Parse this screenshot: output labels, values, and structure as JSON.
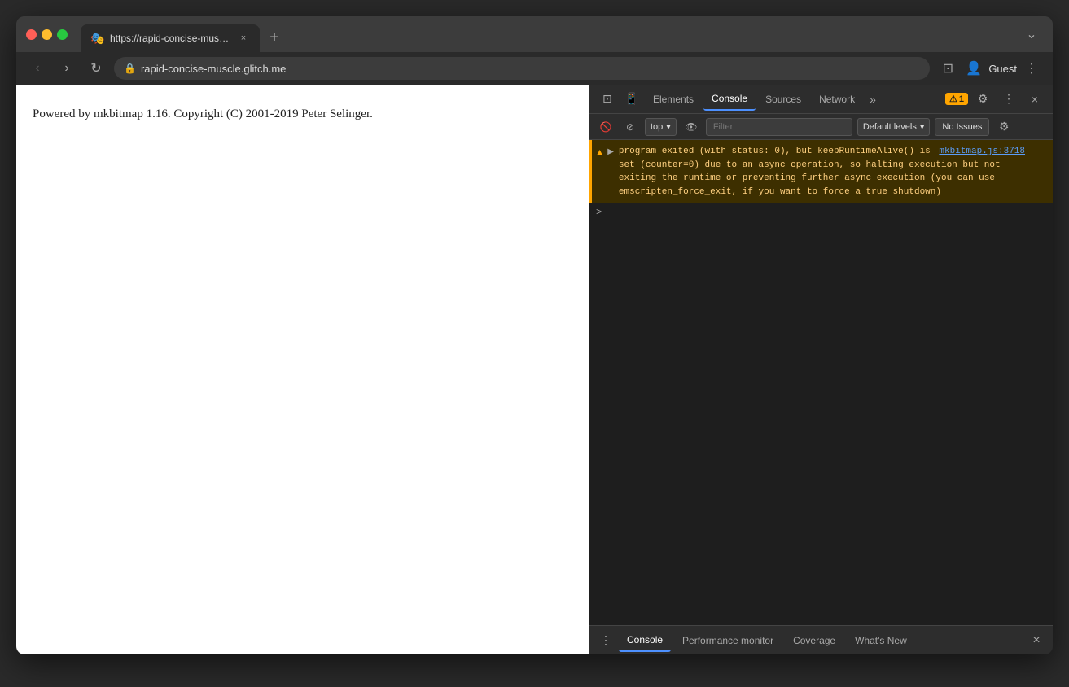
{
  "browser": {
    "tab": {
      "favicon": "🎭",
      "title": "https://rapid-concise-muscle.g...",
      "close_label": "×"
    },
    "new_tab_label": "+",
    "window_controls": {
      "close": "close",
      "minimize": "minimize",
      "maximize": "maximize"
    },
    "address_bar": {
      "url": "rapid-concise-muscle.glitch.me",
      "lock_icon": "🔒"
    },
    "nav": {
      "back_label": "‹",
      "forward_label": "›",
      "reload_label": "↻"
    },
    "profile": "Guest",
    "chevron_label": "⌄"
  },
  "page": {
    "content": "Powered by mkbitmap 1.16. Copyright (C) 2001-2019 Peter Selinger."
  },
  "devtools": {
    "tabs": [
      {
        "label": "Elements",
        "active": false
      },
      {
        "label": "Console",
        "active": true
      },
      {
        "label": "Sources",
        "active": false
      },
      {
        "label": "Network",
        "active": false
      }
    ],
    "more_tabs_label": "»",
    "warning_count": "1",
    "settings_icon": "⚙",
    "more_options_icon": "⋮",
    "close_icon": "×",
    "inspect_icon": "⊡",
    "device_icon": "📱",
    "console": {
      "toolbar": {
        "clear_icon": "🚫",
        "filter_icon": "⊘",
        "context": "top",
        "context_arrow": "▾",
        "eye_icon": "👁",
        "filter_placeholder": "Filter",
        "log_levels": "Default levels",
        "log_levels_arrow": "▾",
        "no_issues": "No Issues",
        "settings_icon": "⚙"
      },
      "warning": {
        "triangle": "▲",
        "expand": "▶",
        "text_line1": " program exited (with status: 0), but keepRuntimeAlive() is",
        "link_text": "mkbitmap.js:3718",
        "text_line2": "set (counter=0) due to an async operation, so halting execution but not",
        "text_line3": "exiting the runtime or preventing further async execution (you can use",
        "text_line4": "emscripten_force_exit, if you want to force a true shutdown)"
      },
      "prompt_arrow": ">"
    },
    "bottom_bar": {
      "more_icon": "⋮",
      "tabs": [
        {
          "label": "Console",
          "active": true
        },
        {
          "label": "Performance monitor",
          "active": false
        },
        {
          "label": "Coverage",
          "active": false
        },
        {
          "label": "What's New",
          "active": false
        }
      ],
      "close_icon": "×"
    }
  }
}
